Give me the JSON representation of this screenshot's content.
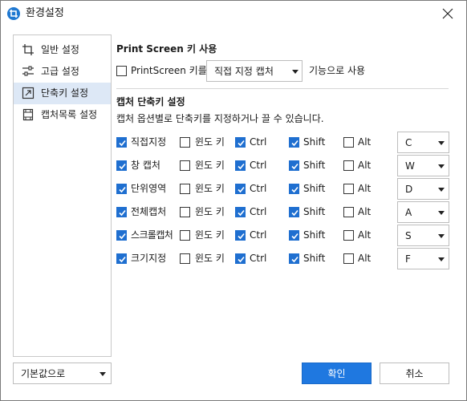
{
  "window": {
    "title": "환경설정",
    "icon": "app-crop-icon",
    "accent": "#1f78d1"
  },
  "sidebar": {
    "items": [
      {
        "label": "일반 설정",
        "icon": "crop-icon",
        "active": false
      },
      {
        "label": "고급 설정",
        "icon": "sliders-icon",
        "active": false
      },
      {
        "label": "단축키 설정",
        "icon": "shortcut-arrow-icon",
        "active": true
      },
      {
        "label": "캡처목록 설정",
        "icon": "film-list-icon",
        "active": false
      }
    ]
  },
  "reset": {
    "label": "기본값으로"
  },
  "printscreen": {
    "title": "Print Screen 키 사용",
    "checkbox_label": "PrintScreen 키를",
    "checked": false,
    "select_value": "직접 지정 캡처",
    "suffix": "기능으로 사용"
  },
  "capture": {
    "title": "캡처 단축키 설정",
    "description": "캡처 옵션별로 단축키를 지정하거나 끌 수 있습니다.",
    "modifier_labels": {
      "win": "윈도 키",
      "ctrl": "Ctrl",
      "shift": "Shift",
      "alt": "Alt"
    },
    "rows": [
      {
        "name": "직접지정",
        "enabled": true,
        "win": false,
        "ctrl": true,
        "shift": true,
        "alt": false,
        "key": "C"
      },
      {
        "name": "창 캡처",
        "enabled": true,
        "win": false,
        "ctrl": true,
        "shift": true,
        "alt": false,
        "key": "W"
      },
      {
        "name": "단위영역",
        "enabled": true,
        "win": false,
        "ctrl": true,
        "shift": true,
        "alt": false,
        "key": "D"
      },
      {
        "name": "전체캡처",
        "enabled": true,
        "win": false,
        "ctrl": true,
        "shift": true,
        "alt": false,
        "key": "A"
      },
      {
        "name": "스크롤캡처",
        "enabled": true,
        "win": false,
        "ctrl": true,
        "shift": true,
        "alt": false,
        "key": "S"
      },
      {
        "name": "크기지정",
        "enabled": true,
        "win": false,
        "ctrl": true,
        "shift": true,
        "alt": false,
        "key": "F"
      }
    ]
  },
  "buttons": {
    "ok": "확인",
    "cancel": "취소"
  },
  "colors": {
    "primary_button": "#1f78e0",
    "checkbox_checked": "#1f6fd0",
    "sidebar_active_bg": "#dde8f6"
  }
}
